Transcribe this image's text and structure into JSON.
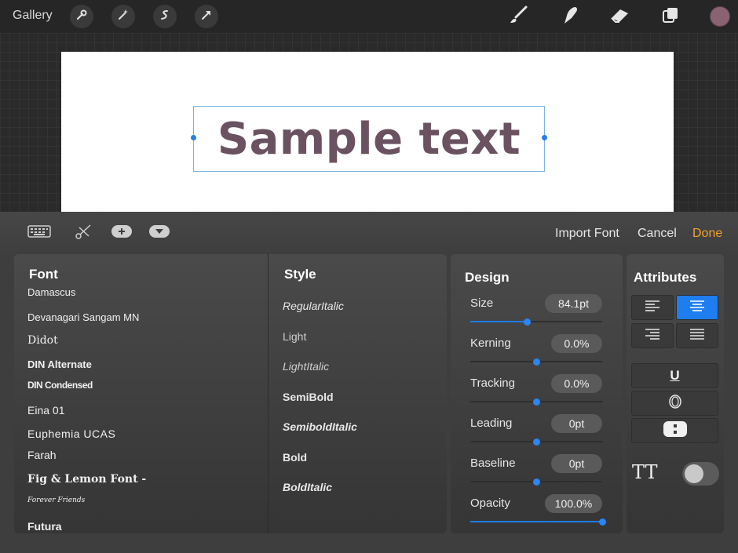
{
  "topbar": {
    "gallery": "Gallery",
    "left_tools": [
      "wrench-icon",
      "magic-wand-icon",
      "selection-icon",
      "transform-arrow-icon"
    ],
    "right_tools": [
      "brush-icon",
      "smudge-icon",
      "eraser-icon",
      "layers-icon"
    ],
    "current_color": "#8a6372"
  },
  "canvas": {
    "sample_text": "Sample text",
    "text_color": "#6b5261"
  },
  "panel": {
    "toolbar_icons": [
      "keyboard-icon",
      "scissors-icon",
      "add-icon",
      "dropdown-icon"
    ],
    "import_font": "Import Font",
    "cancel": "Cancel",
    "done": "Done"
  },
  "font_list": {
    "heading": "Font",
    "items": [
      "Damascus",
      "Devanagari Sangam MN",
      "Didot",
      "DIN Alternate",
      "DIN Condensed",
      "Eina 01",
      "Euphemia UCAS",
      "Farah",
      "Fig & Lemon Font -",
      "Forever Friends",
      "Futura"
    ]
  },
  "style_list": {
    "heading": "Style",
    "items": [
      "RegularItalic",
      "Light",
      "LightItalic",
      "SemiBold",
      "SemiboldItalic",
      "Bold",
      "BoldItalic"
    ]
  },
  "design": {
    "heading": "Design",
    "rows": [
      {
        "label": "Size",
        "value": "84.1pt",
        "level": 0.43
      },
      {
        "label": "Kerning",
        "value": "0.0%",
        "level": 0.5
      },
      {
        "label": "Tracking",
        "value": "0.0%",
        "level": 0.5
      },
      {
        "label": "Leading",
        "value": "0pt",
        "level": 0.5
      },
      {
        "label": "Baseline",
        "value": "0pt",
        "level": 0.5
      },
      {
        "label": "Opacity",
        "value": "100.0%",
        "level": 1.0
      }
    ],
    "accent": "#1f7ae8"
  },
  "attributes": {
    "heading": "Attributes",
    "alignment_selected": "center",
    "underline": "U",
    "all_caps_label": "TT",
    "all_caps_on": false
  }
}
